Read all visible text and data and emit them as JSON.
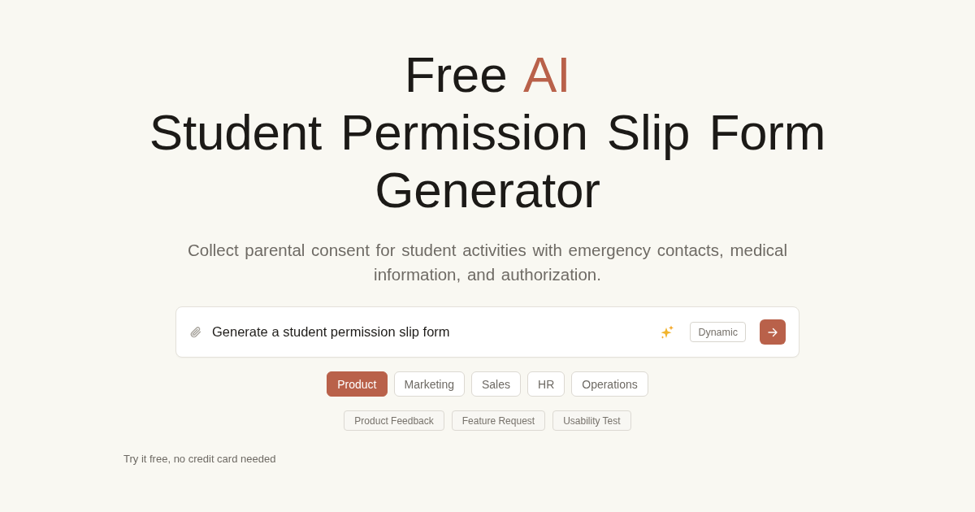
{
  "headline": {
    "lead": "Free",
    "accent": "AI",
    "main": "Student Permission Slip Form Generator"
  },
  "subtitle": "Collect parental consent for student activities with emergency contacts, medical information, and authorization.",
  "prompt": {
    "value": "Generate a student permission slip form",
    "mode": "Dynamic"
  },
  "categories": [
    {
      "label": "Product",
      "selected": true
    },
    {
      "label": "Marketing",
      "selected": false
    },
    {
      "label": "Sales",
      "selected": false
    },
    {
      "label": "HR",
      "selected": false
    },
    {
      "label": "Operations",
      "selected": false
    }
  ],
  "templates": [
    "Product Feedback",
    "Feature Request",
    "Usability Test"
  ],
  "footer_note": "Try it free, no credit card needed"
}
